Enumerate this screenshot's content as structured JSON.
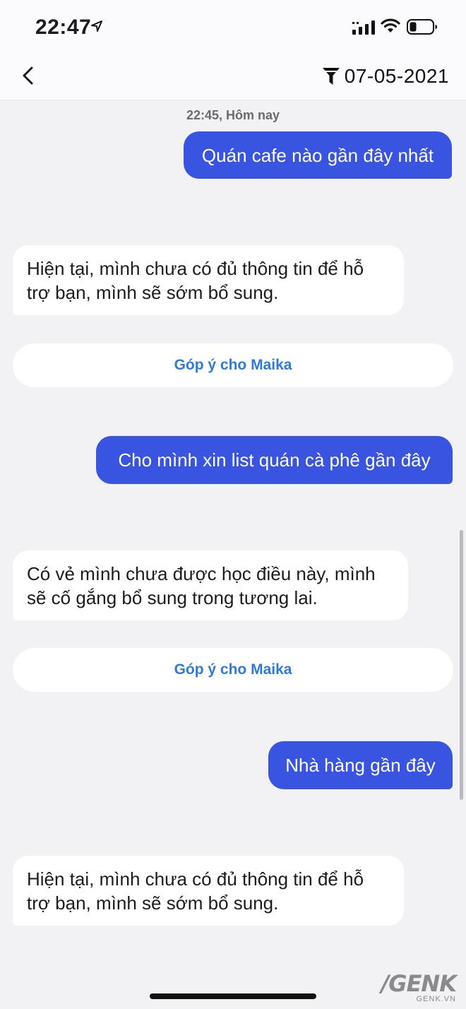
{
  "status_bar": {
    "time": "22:47"
  },
  "nav": {
    "date": "07-05-2021"
  },
  "chat": {
    "timestamp": "22:45, Hôm nay",
    "messages": [
      {
        "role": "user",
        "text": "Quán cafe nào gần đây nhất"
      },
      {
        "role": "bot",
        "text": "Hiện tại, mình chưa có đủ thông tin để hỗ trợ bạn, mình sẽ sớm bổ sung."
      },
      {
        "role": "feedback",
        "text": "Góp ý cho Maika"
      },
      {
        "role": "user",
        "text": "Cho mình xin list quán cà phê gần đây"
      },
      {
        "role": "bot",
        "text": "Có vẻ mình chưa được học điều này, mình sẽ cố gắng bổ sung trong tương lai."
      },
      {
        "role": "feedback",
        "text": "Góp ý cho Maika"
      },
      {
        "role": "user",
        "text": "Nhà hàng gần đây"
      },
      {
        "role": "bot",
        "text": "Hiện tại, mình chưa có đủ thông tin để hỗ trợ bạn, mình sẽ sớm bổ sung."
      }
    ]
  },
  "watermark": {
    "logo": "/GENK",
    "url": "GENK.VN"
  },
  "icons": {
    "back": "chevron-left-icon",
    "filter": "filter-icon",
    "location": "location-arrow-icon",
    "signal": "cellular-signal-icon",
    "wifi": "wifi-icon",
    "battery": "battery-icon"
  },
  "colors": {
    "user_bubble": "#3a54e2",
    "feedback_text": "#2f7ad9",
    "background": "#f2f2f4"
  }
}
